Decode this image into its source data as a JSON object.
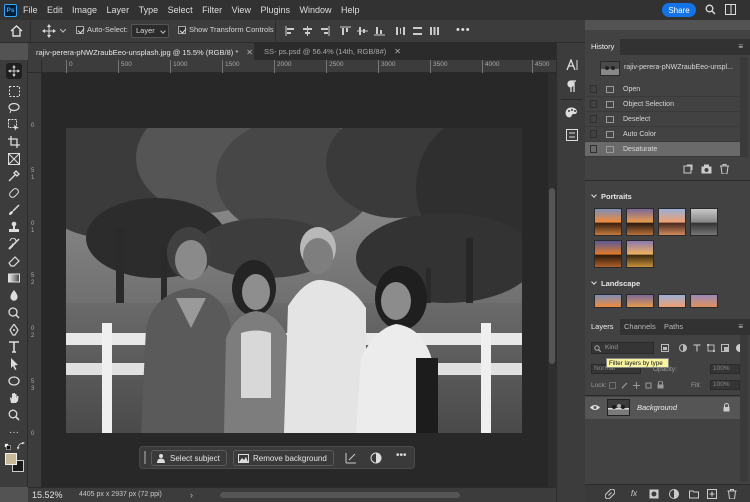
{
  "menubar": {
    "logo": "Ps",
    "items": [
      "File",
      "Edit",
      "Image",
      "Layer",
      "Type",
      "Select",
      "Filter",
      "View",
      "Plugins",
      "Window",
      "Help"
    ],
    "share_label": "Share"
  },
  "options": {
    "auto_select_label": "Auto-Select:",
    "auto_select_checked": true,
    "layer_dropdown": "Layer",
    "transform_controls_label": "Show Transform Controls",
    "transform_controls_checked": true
  },
  "tabs": [
    {
      "title": "rajiv-perera-pNWZraubEeo-unsplash.jpg @ 15.5% (RGB/8) *",
      "active": true
    },
    {
      "title": "SS- ps.psd @ 56.4% (14th, RGB/8#)",
      "active": false
    }
  ],
  "ruler": {
    "h_ticks": [
      "0",
      "500",
      "1000",
      "1500",
      "2000",
      "2500",
      "3000",
      "3500",
      "4000",
      "4500"
    ],
    "v_ticks": [
      "0",
      "5",
      "1",
      "0",
      "1",
      "5",
      "2",
      "0",
      "2",
      "5",
      "3",
      "0"
    ]
  },
  "taskbar": {
    "select_subject": "Select subject",
    "remove_background": "Remove background"
  },
  "status": {
    "zoom": "15.52%",
    "doc_info": "4405 px x 2937 px (72 ppi)"
  },
  "history": {
    "tab": "History",
    "snapshot_name": "rajiv-perera-pNWZraubEeo-unspl...",
    "steps": [
      "Open",
      "Object Selection",
      "Deselect",
      "Auto Color",
      "Desaturate"
    ],
    "active_step": "Desaturate"
  },
  "presets": {
    "portraits_label": "Portraits",
    "landscape_label": "Landscape"
  },
  "layers": {
    "tabs": [
      "Layers",
      "Channels",
      "Paths"
    ],
    "filter_kind": "Kind",
    "tooltip": "Filter layers by type",
    "blend_mode": "Normal",
    "opacity_label": "Opacity:",
    "opacity_value": "100%",
    "lock_label": "Lock:",
    "fill_label": "Fill:",
    "fill_value": "100%",
    "layer_name": "Background"
  },
  "colors": {
    "accent": "#1473e6",
    "foreground_swatch": "#c8b89a",
    "background_swatch": "#1a1a1a"
  }
}
